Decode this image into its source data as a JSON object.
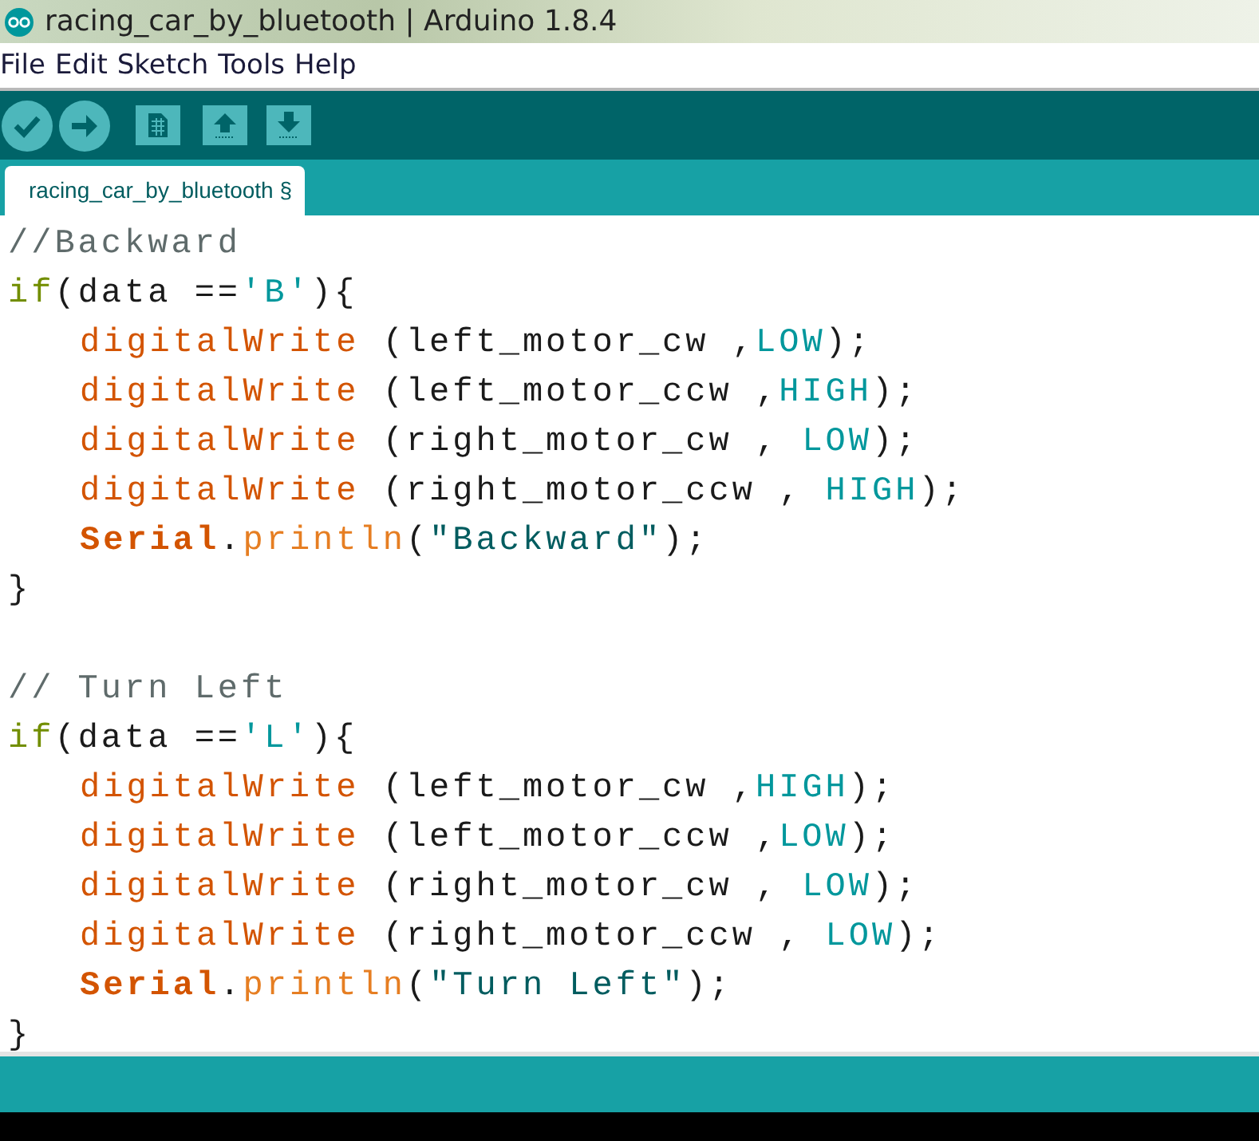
{
  "window": {
    "title": "racing_car_by_bluetooth | Arduino 1.8.4"
  },
  "menu": [
    {
      "label": "File"
    },
    {
      "label": "Edit"
    },
    {
      "label": "Sketch"
    },
    {
      "label": "Tools"
    },
    {
      "label": "Help"
    }
  ],
  "tabs": [
    {
      "label": "racing_car_by_bluetooth §",
      "selected": true
    }
  ],
  "editor": {
    "lines": [
      {
        "kind": "code",
        "indented": false,
        "tokens": [
          {
            "kind": "comment",
            "text": "//Backward"
          }
        ]
      },
      {
        "kind": "code",
        "indented": false,
        "tokens": [
          {
            "kind": "keyword",
            "text": "if"
          },
          {
            "kind": "plain",
            "text": "(data =="
          },
          {
            "kind": "constant",
            "text": "'B'"
          },
          {
            "kind": "plain",
            "text": "){"
          }
        ]
      },
      {
        "kind": "code",
        "indented": true,
        "tokens": [
          {
            "kind": "function",
            "text": "digitalWrite"
          },
          {
            "kind": "plain",
            "text": " (left_motor_cw ,"
          },
          {
            "kind": "constant",
            "text": "LOW"
          },
          {
            "kind": "plain",
            "text": ");"
          }
        ]
      },
      {
        "kind": "code",
        "indented": true,
        "tokens": [
          {
            "kind": "function",
            "text": "digitalWrite"
          },
          {
            "kind": "plain",
            "text": " (left_motor_ccw ,"
          },
          {
            "kind": "constant",
            "text": "HIGH"
          },
          {
            "kind": "plain",
            "text": ");"
          }
        ]
      },
      {
        "kind": "code",
        "indented": true,
        "tokens": [
          {
            "kind": "function",
            "text": "digitalWrite"
          },
          {
            "kind": "plain",
            "text": " (right_motor_cw , "
          },
          {
            "kind": "constant",
            "text": "LOW"
          },
          {
            "kind": "plain",
            "text": ");"
          }
        ]
      },
      {
        "kind": "code",
        "indented": true,
        "tokens": [
          {
            "kind": "function",
            "text": "digitalWrite"
          },
          {
            "kind": "plain",
            "text": " (right_motor_ccw , "
          },
          {
            "kind": "constant",
            "text": "HIGH"
          },
          {
            "kind": "plain",
            "text": ");"
          }
        ]
      },
      {
        "kind": "code",
        "indented": true,
        "tokens": [
          {
            "kind": "class",
            "text": "Serial"
          },
          {
            "kind": "plain",
            "text": "."
          },
          {
            "kind": "method",
            "text": "println"
          },
          {
            "kind": "plain",
            "text": "("
          },
          {
            "kind": "string",
            "text": "\"Backward\""
          },
          {
            "kind": "plain",
            "text": ");"
          }
        ]
      },
      {
        "kind": "code",
        "indented": false,
        "tokens": [
          {
            "kind": "plain",
            "text": "}"
          }
        ]
      },
      {
        "kind": "blank"
      },
      {
        "kind": "code",
        "indented": false,
        "tokens": [
          {
            "kind": "comment",
            "text": "// Turn Left"
          }
        ]
      },
      {
        "kind": "code",
        "indented": false,
        "tokens": [
          {
            "kind": "keyword",
            "text": "if"
          },
          {
            "kind": "plain",
            "text": "(data =="
          },
          {
            "kind": "constant",
            "text": "'L'"
          },
          {
            "kind": "plain",
            "text": "){"
          }
        ]
      },
      {
        "kind": "code",
        "indented": true,
        "tokens": [
          {
            "kind": "function",
            "text": "digitalWrite"
          },
          {
            "kind": "plain",
            "text": " (left_motor_cw ,"
          },
          {
            "kind": "constant",
            "text": "HIGH"
          },
          {
            "kind": "plain",
            "text": ");"
          }
        ]
      },
      {
        "kind": "code",
        "indented": true,
        "tokens": [
          {
            "kind": "function",
            "text": "digitalWrite"
          },
          {
            "kind": "plain",
            "text": " (left_motor_ccw ,"
          },
          {
            "kind": "constant",
            "text": "LOW"
          },
          {
            "kind": "plain",
            "text": ");"
          }
        ]
      },
      {
        "kind": "code",
        "indented": true,
        "tokens": [
          {
            "kind": "function",
            "text": "digitalWrite"
          },
          {
            "kind": "plain",
            "text": " (right_motor_cw , "
          },
          {
            "kind": "constant",
            "text": "LOW"
          },
          {
            "kind": "plain",
            "text": ");"
          }
        ]
      },
      {
        "kind": "code",
        "indented": true,
        "tokens": [
          {
            "kind": "function",
            "text": "digitalWrite"
          },
          {
            "kind": "plain",
            "text": " (right_motor_ccw , "
          },
          {
            "kind": "constant",
            "text": "LOW"
          },
          {
            "kind": "plain",
            "text": ");"
          }
        ]
      },
      {
        "kind": "code",
        "indented": true,
        "tokens": [
          {
            "kind": "class",
            "text": "Serial"
          },
          {
            "kind": "plain",
            "text": "."
          },
          {
            "kind": "method",
            "text": "println"
          },
          {
            "kind": "plain",
            "text": "("
          },
          {
            "kind": "string",
            "text": "\"Turn Left\""
          },
          {
            "kind": "plain",
            "text": ");"
          }
        ]
      },
      {
        "kind": "code",
        "indented": false,
        "tokens": [
          {
            "kind": "plain",
            "text": "}"
          }
        ]
      }
    ]
  }
}
